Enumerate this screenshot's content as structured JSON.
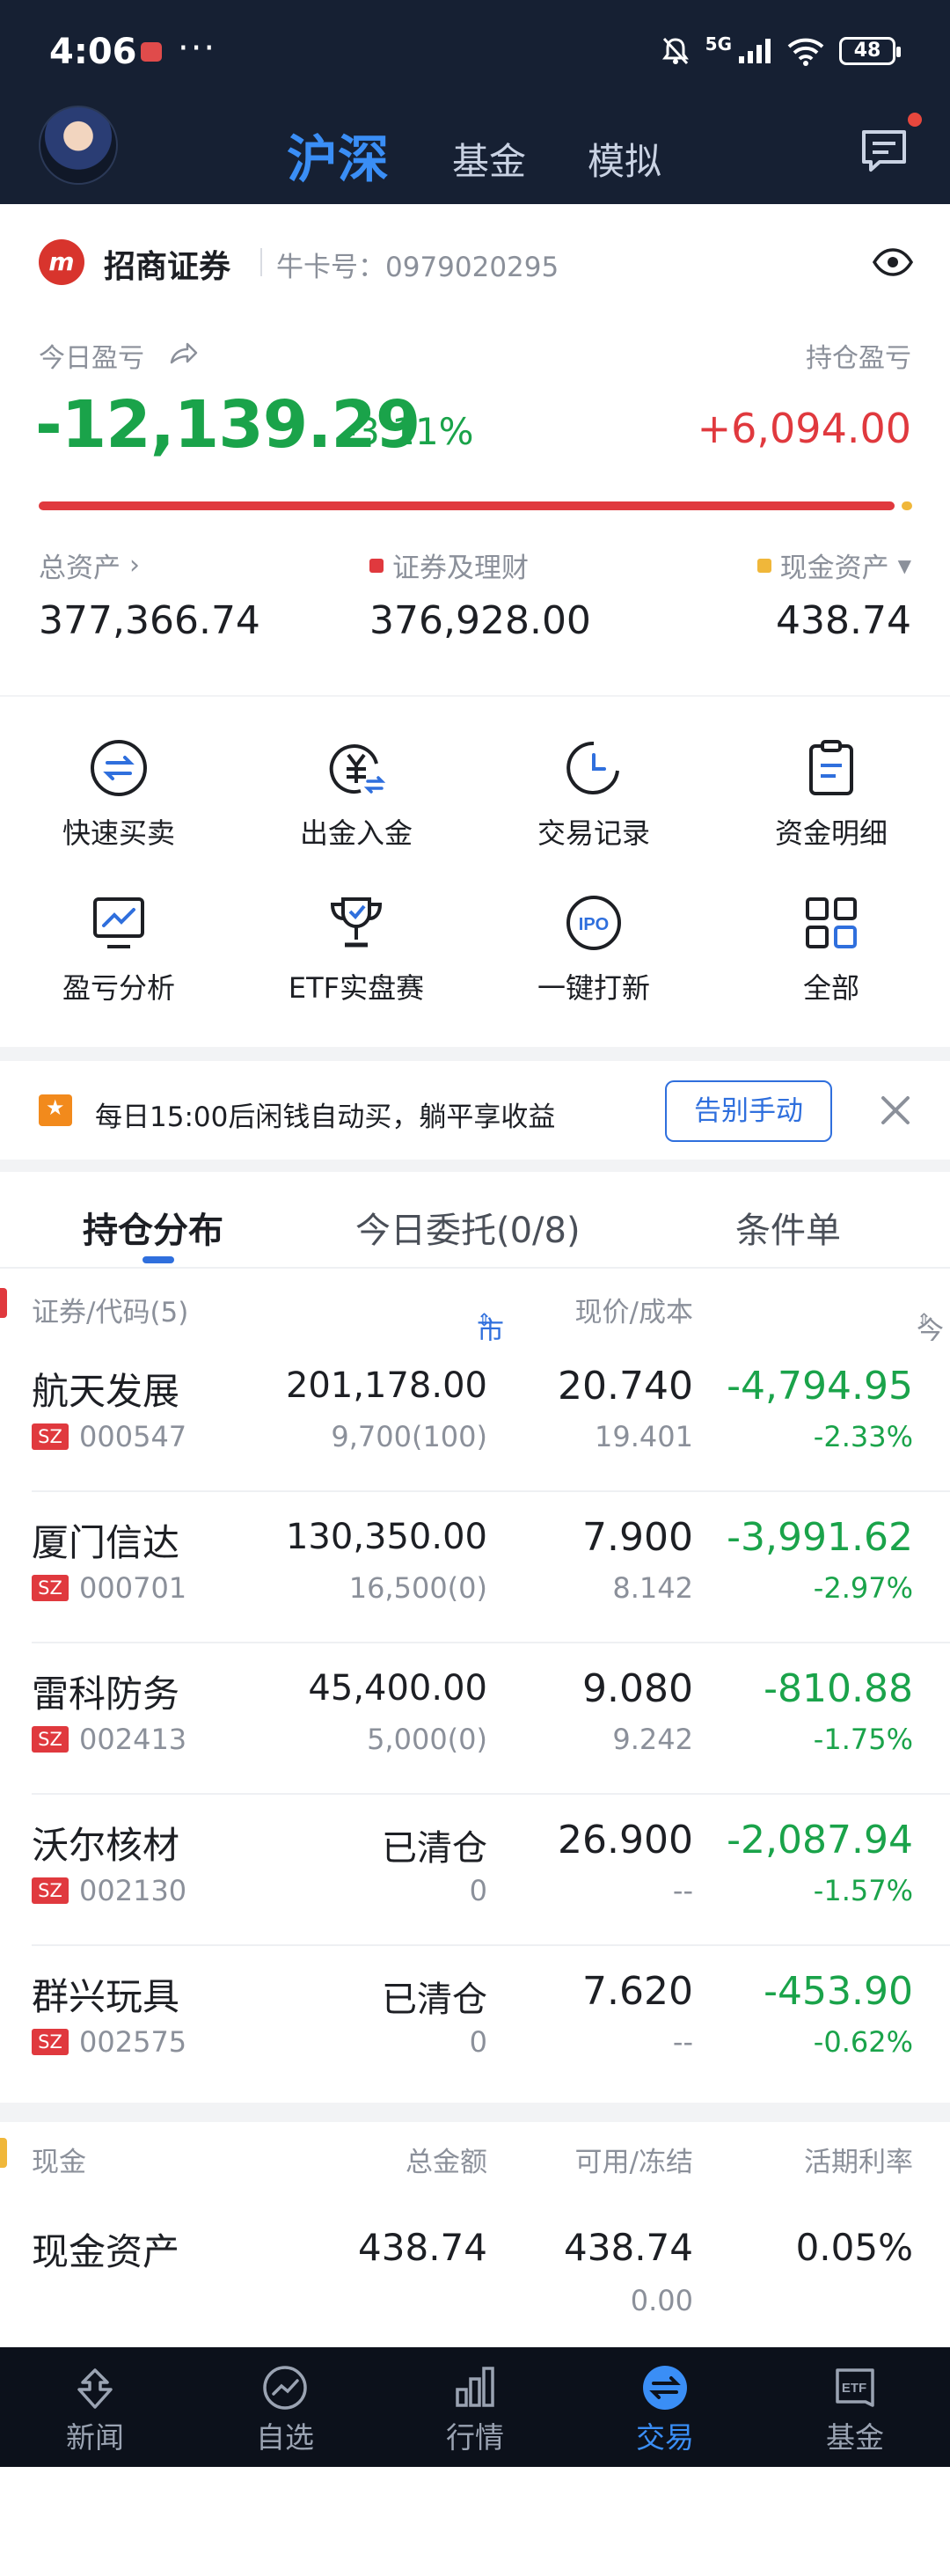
{
  "status_bar": {
    "time": "4:06",
    "more": "···",
    "network": "5G",
    "battery": "48"
  },
  "top_tabs": [
    {
      "label": "沪深",
      "active": true
    },
    {
      "label": "基金",
      "active": false
    },
    {
      "label": "模拟",
      "active": false
    }
  ],
  "account": {
    "broker_name": "招商证券",
    "niuka_label": "牛卡号：",
    "niuka_number": "0979020295",
    "today_pnl_label": "今日盈亏",
    "today_pnl": "-12,139.29",
    "today_pnl_pct": "-3.11%",
    "holding_pnl_label": "持仓盈亏",
    "holding_pnl": "+6,094.00",
    "securities_share": 0.9988,
    "total_assets_label": "总资产",
    "total_assets": "377,366.74",
    "securities_label": "证券及理财",
    "securities_value": "376,928.00",
    "cash_label": "现金资产",
    "cash_value": "438.74"
  },
  "colors": {
    "down": "#1aa34a",
    "up": "#e0393e",
    "accent": "#3a8ef6",
    "cash": "#f0b73a",
    "header": "#162033"
  },
  "quick_menu": [
    {
      "label": "快速买卖",
      "icon": "swap-icon"
    },
    {
      "label": "出金入金",
      "icon": "yuan-transfer-icon"
    },
    {
      "label": "交易记录",
      "icon": "clock-icon"
    },
    {
      "label": "资金明细",
      "icon": "clipboard-icon"
    },
    {
      "label": "盈亏分析",
      "icon": "chart-monitor-icon"
    },
    {
      "label": "ETF实盘赛",
      "icon": "trophy-icon"
    },
    {
      "label": "一键打新",
      "icon": "ipo-icon"
    },
    {
      "label": "全部",
      "icon": "grid-icon"
    }
  ],
  "banner": {
    "text": "每日15:00后闲钱自动买，躺平享收益",
    "button": "告别手动"
  },
  "holding_tabs": [
    {
      "label": "持仓分布",
      "active": true
    },
    {
      "label": "今日委托(0/8)",
      "active": false
    },
    {
      "label": "条件单",
      "active": false
    }
  ],
  "holdings_header": {
    "col1": "证券/代码(5)",
    "col2": "市值/股数(可卖)",
    "col3": "现价/成本",
    "col4": "今日盈亏"
  },
  "holdings": [
    {
      "name": "航天发展",
      "market": "SZ",
      "code": "000547",
      "market_value": "201,178.00",
      "shares": "9,700(100)",
      "price": "20.740",
      "cost": "19.401",
      "pnl": "-4,794.95",
      "pnl_pct": "-2.33%"
    },
    {
      "name": "厦门信达",
      "market": "SZ",
      "code": "000701",
      "market_value": "130,350.00",
      "shares": "16,500(0)",
      "price": "7.900",
      "cost": "8.142",
      "pnl": "-3,991.62",
      "pnl_pct": "-2.97%"
    },
    {
      "name": "雷科防务",
      "market": "SZ",
      "code": "002413",
      "market_value": "45,400.00",
      "shares": "5,000(0)",
      "price": "9.080",
      "cost": "9.242",
      "pnl": "-810.88",
      "pnl_pct": "-1.75%"
    },
    {
      "name": "沃尔核材",
      "market": "SZ",
      "code": "002130",
      "market_value": "已清仓",
      "shares": "0",
      "price": "26.900",
      "cost": "--",
      "pnl": "-2,087.94",
      "pnl_pct": "-1.57%"
    },
    {
      "name": "群兴玩具",
      "market": "SZ",
      "code": "002575",
      "market_value": "已清仓",
      "shares": "0",
      "price": "7.620",
      "cost": "--",
      "pnl": "-453.90",
      "pnl_pct": "-0.62%"
    }
  ],
  "cash_header": {
    "col1": "现金",
    "col2": "总金额",
    "col3": "可用/冻结",
    "col4": "活期利率"
  },
  "cash_row": {
    "name": "现金资产",
    "total": "438.74",
    "available": "438.74",
    "frozen": "0.00",
    "rate": "0.05%"
  },
  "bottom_nav": [
    {
      "label": "新闻",
      "icon": "news-icon",
      "active": false
    },
    {
      "label": "自选",
      "icon": "trend-icon",
      "active": false
    },
    {
      "label": "行情",
      "icon": "bar-chart-icon",
      "active": false
    },
    {
      "label": "交易",
      "icon": "trade-icon",
      "active": true
    },
    {
      "label": "基金",
      "icon": "etf-icon",
      "active": false
    }
  ]
}
